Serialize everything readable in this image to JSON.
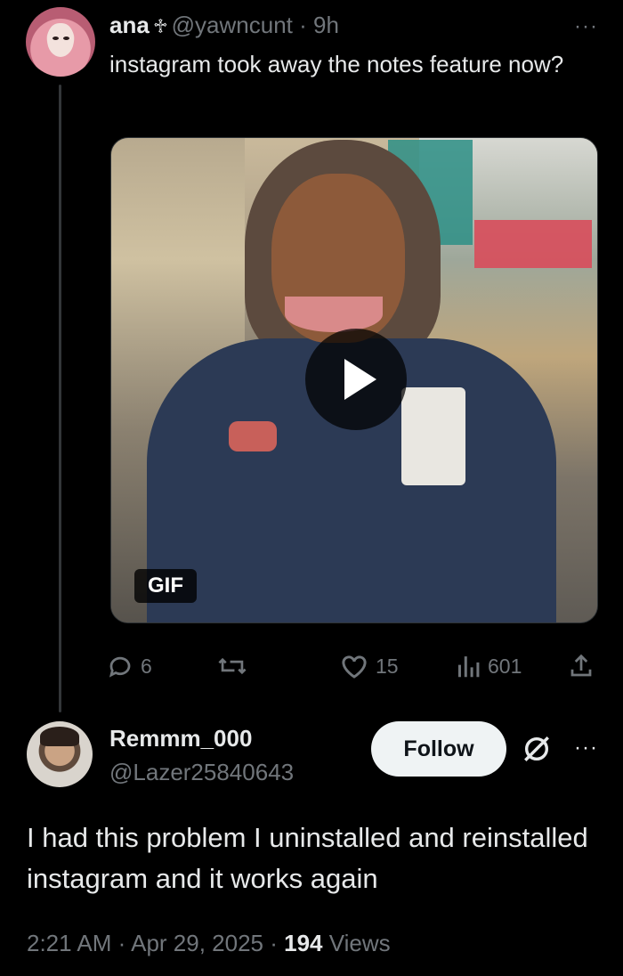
{
  "parent_post": {
    "author_name": "ana",
    "author_symbol": "♱",
    "handle": "@yawncunt",
    "separator": "·",
    "time": "9h",
    "more": "···",
    "text": "instagram took away the notes feature now?",
    "media": {
      "type_label": "GIF"
    },
    "actions": {
      "replies": "6",
      "reposts": "",
      "likes": "15",
      "views": "601"
    }
  },
  "reply_post": {
    "author_name": "Remmm_000",
    "handle": "@Lazer25840643",
    "follow_label": "Follow",
    "more": "···",
    "text": "I had this problem I uninstalled and reinstalled instagram and it works again",
    "time": "2:21 AM",
    "separator": "·",
    "date": "Apr 29, 2025",
    "separator2": "·",
    "views_count": "194",
    "views_label": "Views"
  },
  "colors": {
    "background": "#000000",
    "text": "#e7e9ea",
    "muted": "#71767b",
    "follow_bg": "#eff3f4"
  }
}
